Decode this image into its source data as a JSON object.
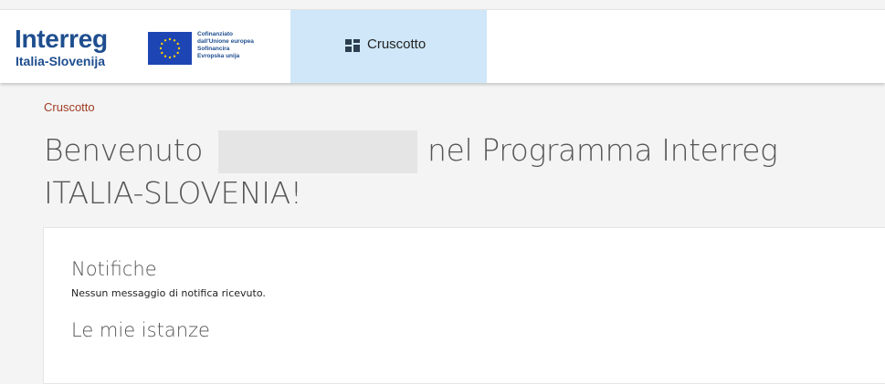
{
  "header": {
    "logo": {
      "title": "Interreg",
      "subtitle": "Italia-Slovenija",
      "brand_color": "#1e4e8f"
    },
    "eu_emblem": {
      "icon": "eu-flag-icon",
      "flag_color": "#1e45b4",
      "star_color": "#ffd200",
      "lines": [
        "Cofinanziato",
        "dall'Unione europea",
        "Sofinancira",
        "Evropska unija"
      ]
    },
    "nav": {
      "active_tab": {
        "label": "Cruscotto",
        "icon": "dashboard-icon",
        "background": "#cfe7f8"
      }
    }
  },
  "breadcrumb": {
    "label": "Cruscotto",
    "color": "#9e3b22"
  },
  "page": {
    "title_before": "Benvenuto",
    "title_after": "nel Programma Interreg ITALIA-SLOVENIA!"
  },
  "card": {
    "notifications": {
      "title": "Notifiche",
      "message": "Nessun messaggio di notifica ricevuto."
    },
    "instances": {
      "title": "Le mie istanze"
    }
  }
}
